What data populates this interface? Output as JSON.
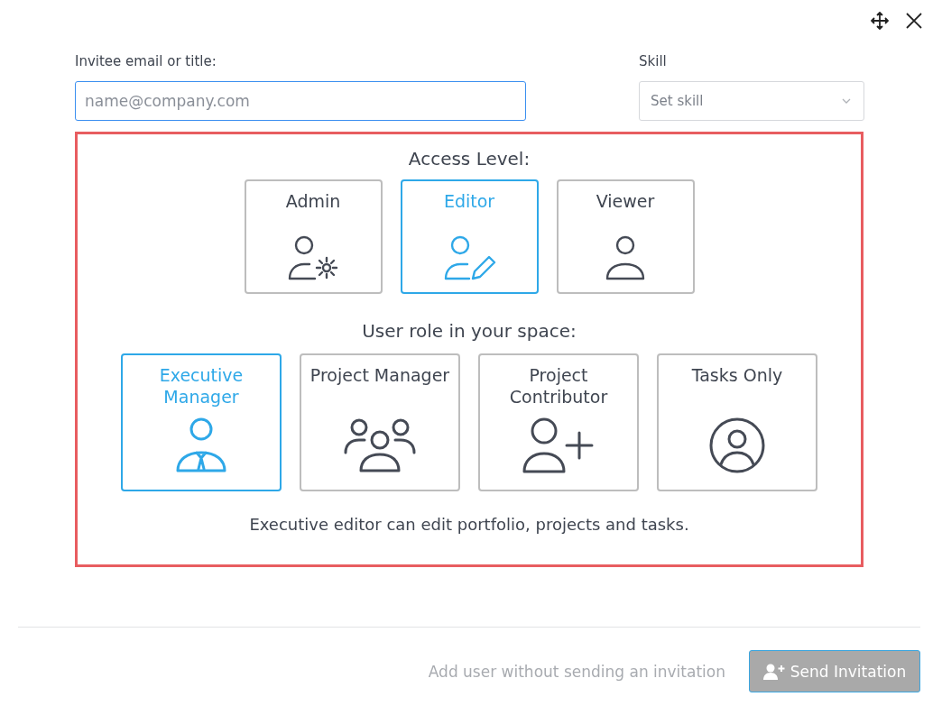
{
  "email": {
    "label": "Invitee email or title:",
    "placeholder": "name@company.com"
  },
  "skill": {
    "label": "Skill",
    "placeholder": "Set skill"
  },
  "access": {
    "title": "Access Level:",
    "options": [
      {
        "label": "Admin",
        "kind": "admin",
        "selected": false
      },
      {
        "label": "Editor",
        "kind": "editor",
        "selected": true
      },
      {
        "label": "Viewer",
        "kind": "viewer",
        "selected": false
      }
    ]
  },
  "roles": {
    "title": "User role in your space:",
    "options": [
      {
        "label": "Executive Manager",
        "kind": "executive",
        "selected": true
      },
      {
        "label": "Project Manager",
        "kind": "team",
        "selected": false
      },
      {
        "label": "Project Contributor",
        "kind": "add",
        "selected": false
      },
      {
        "label": "Tasks Only",
        "kind": "circle",
        "selected": false
      }
    ],
    "description": "Executive editor can edit portfolio, projects and tasks."
  },
  "footer": {
    "link": "Add user without sending an invitation",
    "button": "Send Invitation"
  }
}
